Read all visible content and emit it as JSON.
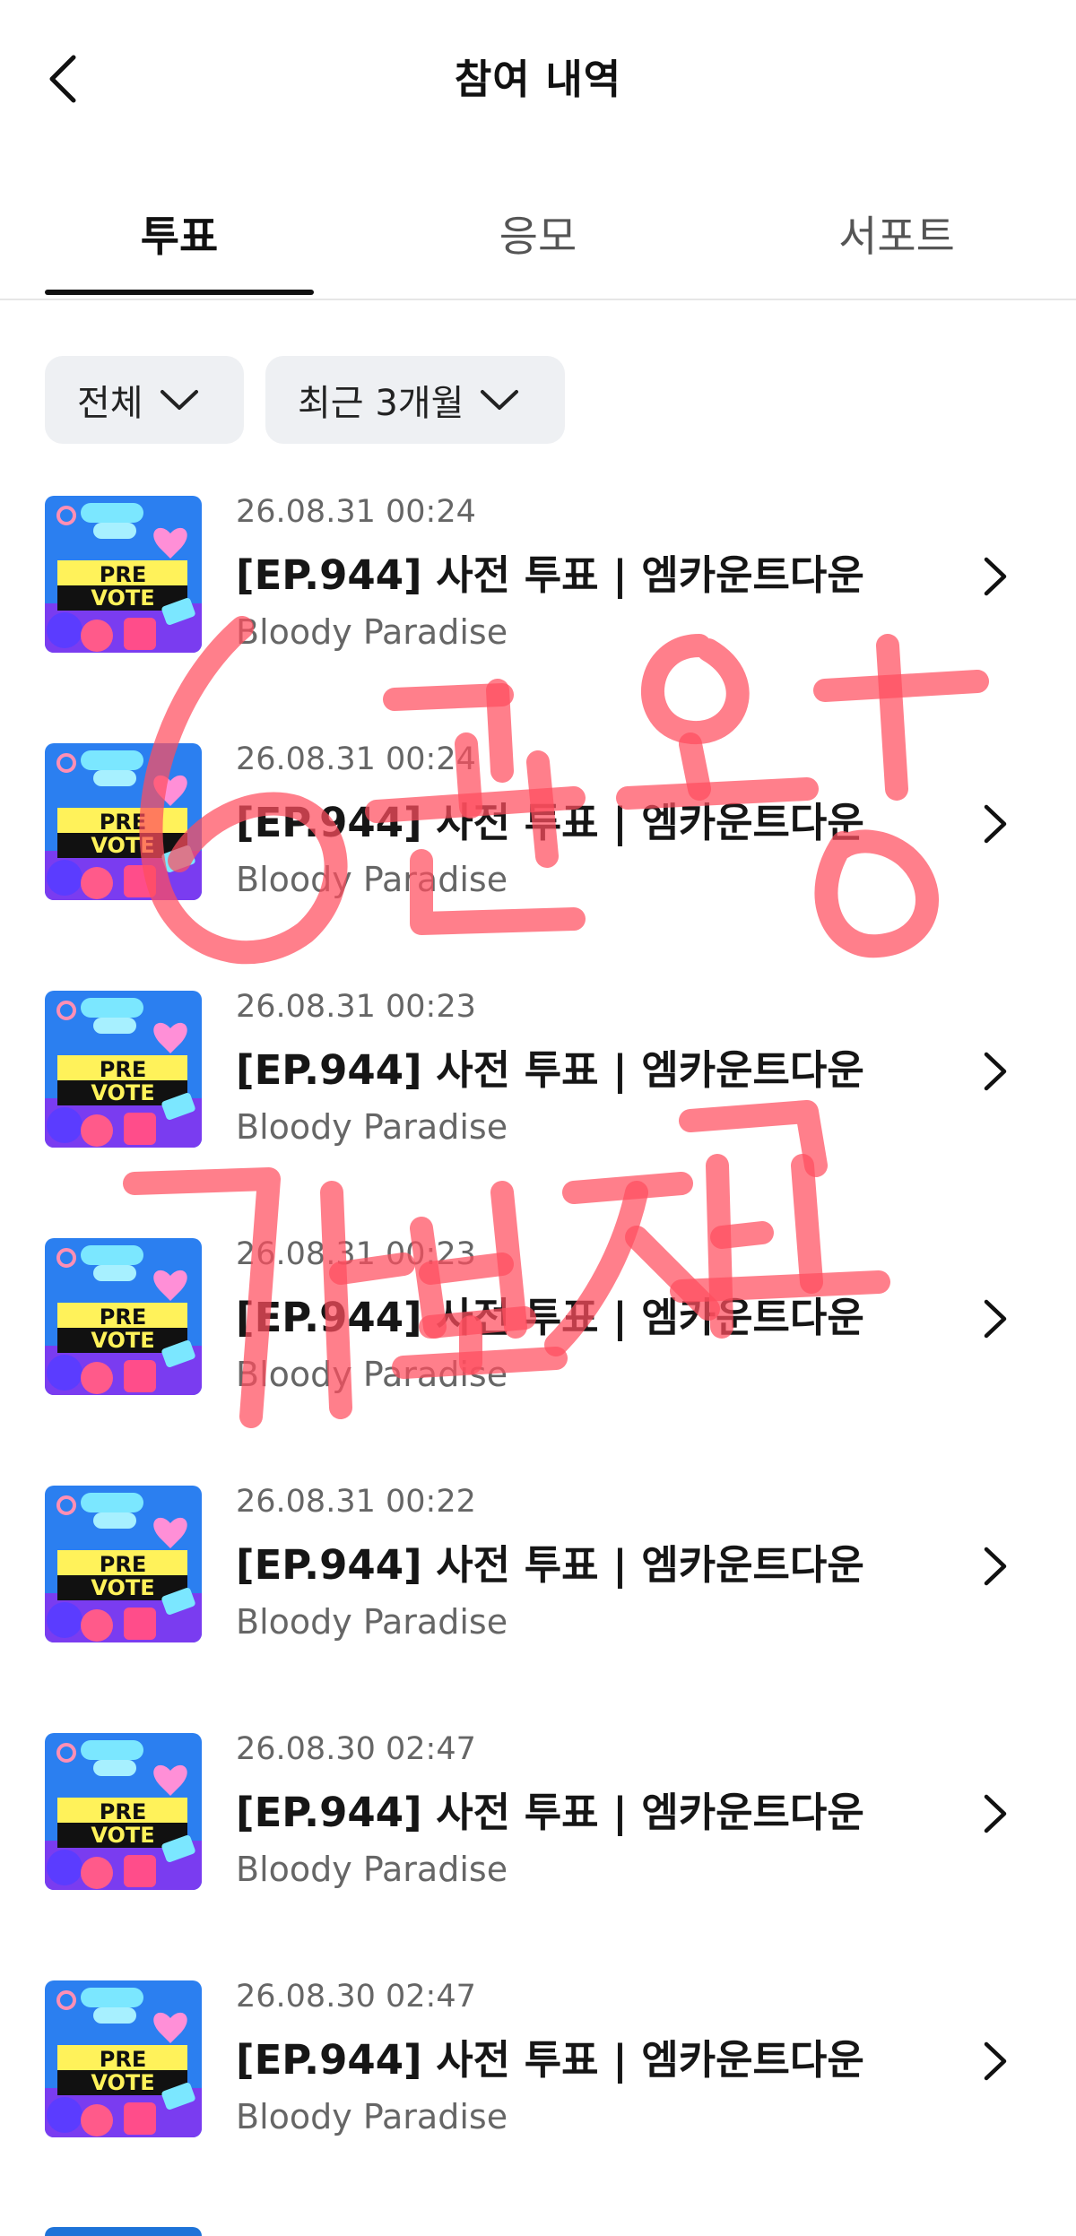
{
  "header": {
    "title": "참여 내역"
  },
  "tabs": [
    {
      "label": "투표",
      "active": true
    },
    {
      "label": "응모",
      "active": false
    },
    {
      "label": "서포트",
      "active": false
    }
  ],
  "filters": [
    {
      "label": "전체"
    },
    {
      "label": "최근 3개월"
    }
  ],
  "thumbnail": {
    "line1": "PRE",
    "line2": "VOTE"
  },
  "items": [
    {
      "date": "26.08.31 00:24",
      "title": "[EP.944] 사전 투표 | 엠카운트다운",
      "subtitle": "Bloody Paradise"
    },
    {
      "date": "26.08.31 00:24",
      "title": "[EP.944] 사전 투표 | 엠카운트다운",
      "subtitle": "Bloody Paradise"
    },
    {
      "date": "26.08.31 00:23",
      "title": "[EP.944] 사전 투표 | 엠카운트다운",
      "subtitle": "Bloody Paradise"
    },
    {
      "date": "26.08.31 00:23",
      "title": "[EP.944] 사전 투표 | 엠카운트다운",
      "subtitle": "Bloody Paradise"
    },
    {
      "date": "26.08.31 00:22",
      "title": "[EP.944] 사전 투표 | 엠카운트다운",
      "subtitle": "Bloody Paradise"
    },
    {
      "date": "26.08.30 02:47",
      "title": "[EP.944] 사전 투표 | 엠카운트다운",
      "subtitle": "Bloody Paradise"
    },
    {
      "date": "26.08.30 02:47",
      "title": "[EP.944] 사전 투표 | 엠카운트다운",
      "subtitle": "Bloody Paradise"
    }
  ],
  "overlay": {
    "line1": "6관왕",
    "line2": "가보자고",
    "color": "#ff4d5e"
  }
}
